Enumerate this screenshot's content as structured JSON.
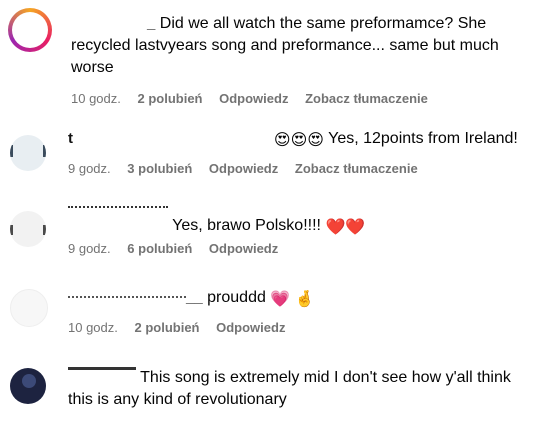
{
  "comments": [
    {
      "username": "_",
      "text": "Did we all watch the same preformamce? She recycled lastvyears song and preformance... same but much worse",
      "time": "10 godz.",
      "likes": "2 polubień",
      "reply": "Odpowiedz",
      "translate": "Zobacz tłumaczenie"
    },
    {
      "username": "t",
      "text": "Yes, 12points from Ireland!",
      "time": "9 godz.",
      "likes": "3 polubień",
      "reply": "Odpowiedz",
      "translate": "Zobacz tłumaczenie"
    },
    {
      "username": "",
      "text": "Yes, brawo Polsko!!!!",
      "time": "9 godz.",
      "likes": "6 polubień",
      "reply": "Odpowiedz"
    },
    {
      "username": "__",
      "text": "prouddd",
      "time": "10 godz.",
      "likes": "2 polubień",
      "reply": "Odpowiedz"
    },
    {
      "username": "",
      "text": "This song is extremely mid I don't see how y'all think this is any kind of revolutionary"
    }
  ],
  "colors": {
    "meta_gray": "#737373",
    "heart_red": "#e8274b",
    "heart_pink": "#ff3b7a"
  }
}
